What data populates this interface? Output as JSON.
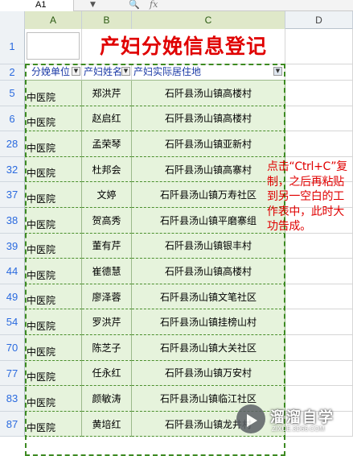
{
  "formula_bar": {
    "cell_ref": "A1",
    "fx_label": "fx"
  },
  "columns": [
    "A",
    "B",
    "C",
    "D"
  ],
  "rows": [
    {
      "num": "1"
    },
    {
      "num": "2"
    },
    {
      "num": "5",
      "a": "中医院",
      "b": "郑洪芹",
      "c": "石阡县汤山镇高楼村"
    },
    {
      "num": "6",
      "a": "中医院",
      "b": "赵启红",
      "c": "石阡县汤山镇高楼村"
    },
    {
      "num": "28",
      "a": "中医院",
      "b": "孟荣琴",
      "c": "石阡县汤山镇亚新村"
    },
    {
      "num": "32",
      "a": "中医院",
      "b": "杜邦会",
      "c": "石阡县汤山镇高寨村"
    },
    {
      "num": "37",
      "a": "中医院",
      "b": "文婷",
      "c": "石阡县汤山镇万寿社区"
    },
    {
      "num": "38",
      "a": "中医院",
      "b": "贺高秀",
      "c": "石阡县汤山镇平磨寨组"
    },
    {
      "num": "39",
      "a": "中医院",
      "b": "董有芹",
      "c": "石阡县汤山镇银丰村"
    },
    {
      "num": "44",
      "a": "中医院",
      "b": "崔德慧",
      "c": "石阡县汤山镇高楼村"
    },
    {
      "num": "49",
      "a": "中医院",
      "b": "廖泽蓉",
      "c": "石阡县汤山镇文笔社区"
    },
    {
      "num": "54",
      "a": "中医院",
      "b": "罗洪芹",
      "c": "石阡县汤山镇挂榜山村"
    },
    {
      "num": "70",
      "a": "中医院",
      "b": "陈芝子",
      "c": "石阡县汤山镇大关社区"
    },
    {
      "num": "77",
      "a": "中医院",
      "b": "任永红",
      "c": "石阡县汤山镇万安村"
    },
    {
      "num": "83",
      "a": "中医院",
      "b": "颜敏涛",
      "c": "石阡县汤山镇临江社区"
    },
    {
      "num": "87",
      "a": "中医院",
      "b": "黄培红",
      "c": "石阡县汤山镇龙井村"
    }
  ],
  "title": "产妇分娩信息登记",
  "headers": {
    "a": "分娩单位",
    "b": "产妇姓名",
    "c": "产妇实际居住地"
  },
  "annotation": "点击“Ctrl+C”复制，之后再粘贴到另一空白的工作表中，此时大功告成。",
  "watermark": {
    "title": "溜溜自学",
    "url": "ZIXUE.3D66.COM",
    "icon": "play-icon"
  },
  "colors": {
    "title_red": "#e00000",
    "selection_green": "#3d8a22",
    "row_fill": "#e6f3dc",
    "row_number_blue": "#2a6adf"
  }
}
